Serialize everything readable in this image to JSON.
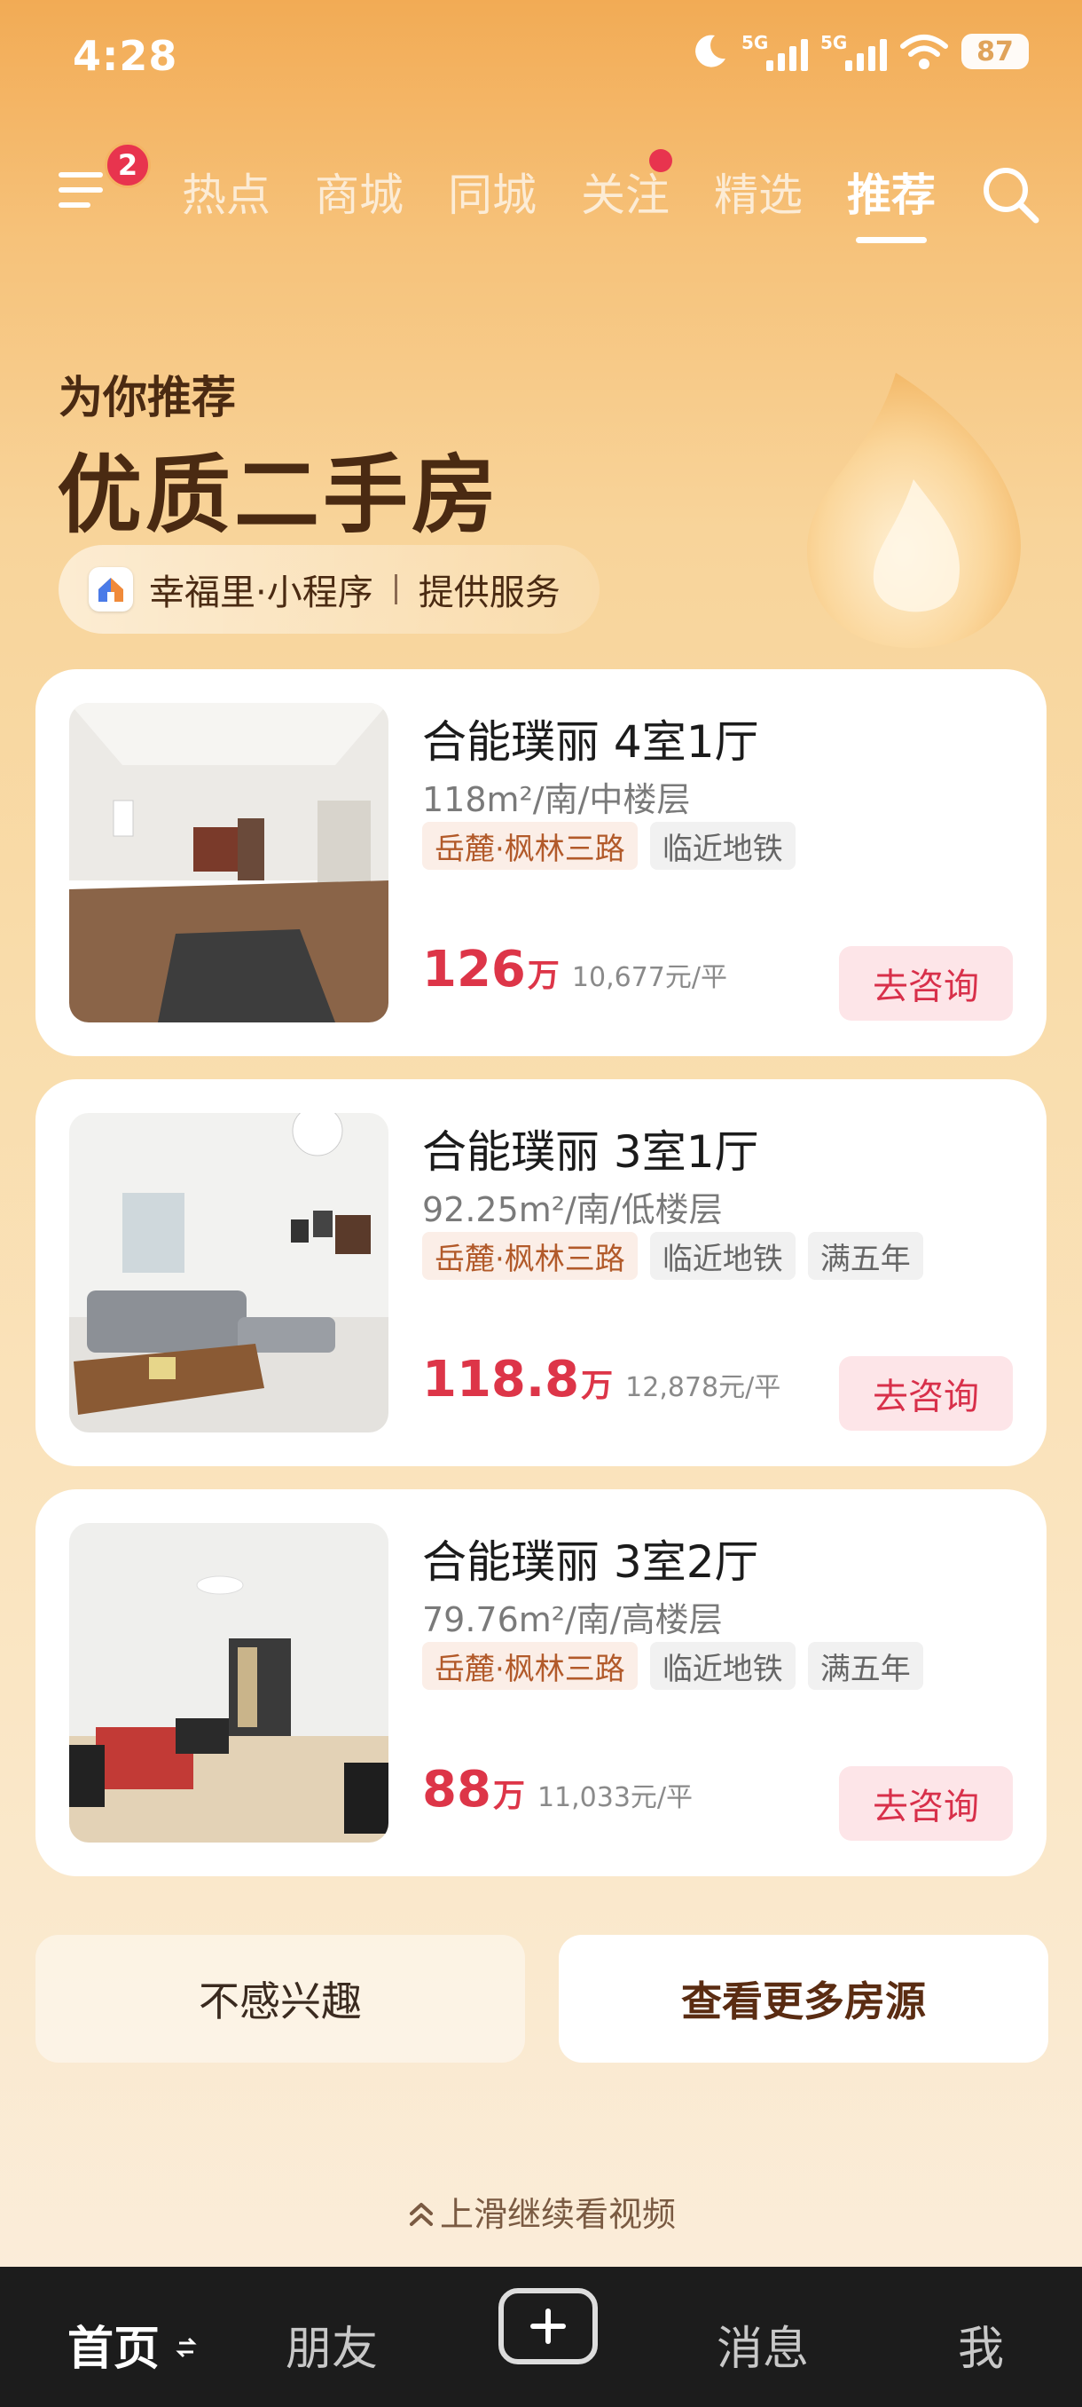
{
  "status_bar": {
    "time": "4:28",
    "signal_1_label": "5G",
    "signal_2_label": "5G",
    "battery": "87",
    "icons": [
      "moon-icon",
      "signal-icon",
      "signal-icon",
      "wifi-icon",
      "battery-icon"
    ]
  },
  "top_nav": {
    "menu_badge": "2",
    "tabs": [
      {
        "label": "热点"
      },
      {
        "label": "商城"
      },
      {
        "label": "同城"
      },
      {
        "label": "关注"
      },
      {
        "label": "精选"
      },
      {
        "label": "推荐"
      }
    ],
    "active_tab": "推荐"
  },
  "hero": {
    "subtitle": "为你推荐",
    "title": "优质二手房",
    "service_app": "幸福里·小程序",
    "service_text": "提供服务"
  },
  "listings": [
    {
      "title": "合能璞丽 4室1厅",
      "meta": "118m²/南/中楼层",
      "tags": [
        {
          "text": "岳麓·枫林三路",
          "type": "loc"
        },
        {
          "text": "临近地铁",
          "type": "plain"
        }
      ],
      "price": "126",
      "price_unit": "万",
      "unit_price": "10,677元/平",
      "action": "去咨询"
    },
    {
      "title": "合能璞丽 3室1厅",
      "meta": "92.25m²/南/低楼层",
      "tags": [
        {
          "text": "岳麓·枫林三路",
          "type": "loc"
        },
        {
          "text": "临近地铁",
          "type": "plain"
        },
        {
          "text": "满五年",
          "type": "plain"
        }
      ],
      "price": "118.8",
      "price_unit": "万",
      "unit_price": "12,878元/平",
      "action": "去咨询"
    },
    {
      "title": "合能璞丽 3室2厅",
      "meta": "79.76m²/南/高楼层",
      "tags": [
        {
          "text": "岳麓·枫林三路",
          "type": "loc"
        },
        {
          "text": "临近地铁",
          "type": "plain"
        },
        {
          "text": "满五年",
          "type": "plain"
        }
      ],
      "price": "88",
      "price_unit": "万",
      "unit_price": "11,033元/平",
      "action": "去咨询"
    }
  ],
  "actions": {
    "not_interested": "不感兴趣",
    "more_listings": "查看更多房源"
  },
  "swipe_hint": "上滑继续看视频",
  "tab_bar": {
    "home": "首页",
    "friends": "朋友",
    "messages": "消息",
    "me": "我"
  },
  "colors": {
    "accent_price": "#dd3548",
    "badge_red": "#e8344e",
    "heading_brown": "#4a2a12"
  }
}
